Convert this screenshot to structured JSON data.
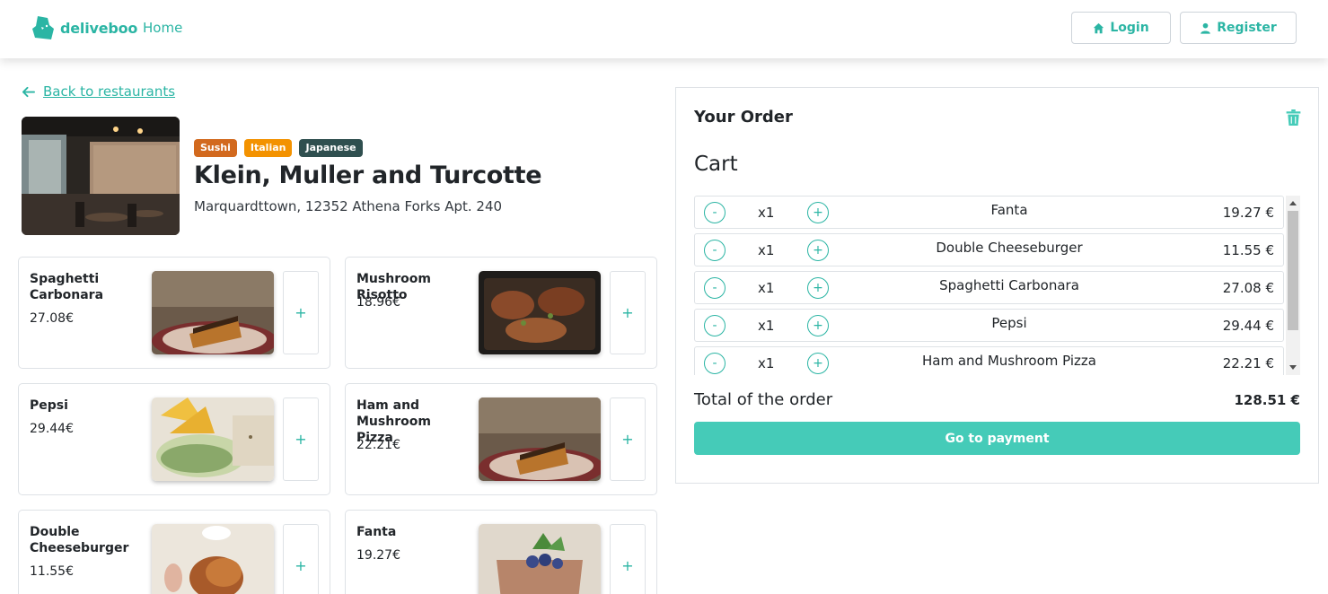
{
  "header": {
    "brand": "deliveboo",
    "home_link": "Home",
    "login_label": "Login",
    "register_label": "Register",
    "accent_color": "#2bb5a4"
  },
  "back_link": "Back to restaurants",
  "restaurant": {
    "name": "Klein, Muller and Turcotte",
    "address": "Marquardttown, 12352 Athena Forks Apt. 240",
    "categories": [
      {
        "label": "Sushi",
        "color": "#d2691e"
      },
      {
        "label": "Italian",
        "color": "#f39200"
      },
      {
        "label": "Japanese",
        "color": "#2f4f4f"
      }
    ]
  },
  "menu": [
    {
      "name": "Spaghetti Carbonara",
      "price": "27.08€",
      "add": "+"
    },
    {
      "name": "Mushroom Risotto",
      "price": "18.96€",
      "add": "+"
    },
    {
      "name": "Pepsi",
      "price": "29.44€",
      "add": "+"
    },
    {
      "name": "Ham and Mushroom Pizza",
      "price": "22.21€",
      "add": "+"
    },
    {
      "name": "Double Cheeseburger",
      "price": "11.55€",
      "add": "+"
    },
    {
      "name": "Fanta",
      "price": "19.27€",
      "add": "+"
    }
  ],
  "order": {
    "title": "Your Order",
    "cart_title": "Cart",
    "minus": "-",
    "plus": "+",
    "items": [
      {
        "qty": "x1",
        "name": "Fanta",
        "price": "19.27 €"
      },
      {
        "qty": "x1",
        "name": "Double Cheeseburger",
        "price": "11.55 €"
      },
      {
        "qty": "x1",
        "name": "Spaghetti Carbonara",
        "price": "27.08 €"
      },
      {
        "qty": "x1",
        "name": "Pepsi",
        "price": "29.44 €"
      },
      {
        "qty": "x1",
        "name": "Ham and Mushroom Pizza",
        "price": "22.21 €"
      }
    ],
    "total_label": "Total of the order",
    "total_value": "128.51 €",
    "pay_label": "Go to payment"
  }
}
